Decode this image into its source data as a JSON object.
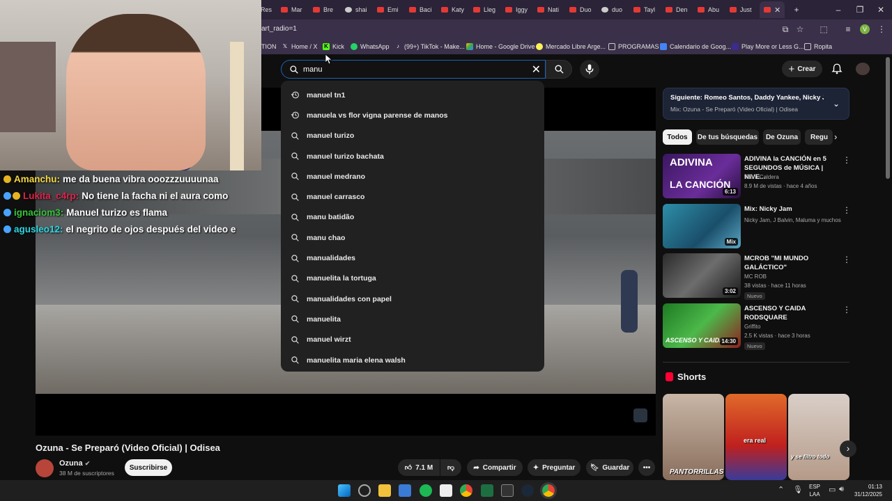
{
  "browser": {
    "tabs": [
      "Res",
      "Mar",
      "Bre",
      "shai",
      "Emi",
      "Baci",
      "Katy",
      "Lleg",
      "Iggy",
      "Nati",
      "Duo",
      "duo",
      "Tayl",
      "Den",
      "Abu",
      "Just"
    ],
    "new_tab": "+",
    "url": "art_radio=1",
    "bookmarks": [
      "TION",
      "Home / X",
      "Kick",
      "WhatsApp",
      "(99+) TikTok - Make...",
      "Home - Google Drive",
      "Mercado Libre Arge...",
      "PROGRAMAS",
      "Calendario de Goog...",
      "Play More or Less G...",
      "Ropita"
    ],
    "profile_initial": "V"
  },
  "chat": [
    {
      "user": "Amanchu:",
      "msg": "me da buena vibra ooozzzuuuunaa",
      "color": "#f5d742"
    },
    {
      "user": "Lukita_c4rp:",
      "msg": "No tiene la facha ni el aura como",
      "color": "#e0244c"
    },
    {
      "user": "ignaciom3:",
      "msg": "Manuel turizo es flama",
      "color": "#35c43a"
    },
    {
      "user": "agusleo12:",
      "msg": "el negrito de ojos después del video e",
      "color": "#2bd6e0"
    }
  ],
  "youtube": {
    "search_value": "manu",
    "suggestions": [
      {
        "text": "manuel tn1",
        "icon": "history-icon"
      },
      {
        "text": "manuela vs flor vigna parense de manos",
        "icon": "history-icon"
      },
      {
        "text": "manuel turizo",
        "icon": "search-icon"
      },
      {
        "text": "manuel turizo bachata",
        "icon": "search-icon"
      },
      {
        "text": "manuel medrano",
        "icon": "search-icon"
      },
      {
        "text": "manuel carrasco",
        "icon": "search-icon"
      },
      {
        "text": "manu batidão",
        "icon": "search-icon"
      },
      {
        "text": "manu chao",
        "icon": "search-icon"
      },
      {
        "text": "manualidades",
        "icon": "search-icon"
      },
      {
        "text": "manuelita la tortuga",
        "icon": "search-icon"
      },
      {
        "text": "manualidades con papel",
        "icon": "search-icon"
      },
      {
        "text": "manuelita",
        "icon": "search-icon"
      },
      {
        "text": "manuel wirzt",
        "icon": "search-icon"
      },
      {
        "text": "manuelita maria elena walsh",
        "icon": "search-icon"
      }
    ],
    "create_label": "Crear",
    "video": {
      "title": "Ozuna - Se Preparó (Video Oficial) | Odisea",
      "channel": "Ozuna",
      "subscribers": "38 M de suscriptores",
      "subscribe_label": "Suscribirse",
      "likes": "7.1 M",
      "share_label": "Compartir",
      "ask_label": "Preguntar",
      "save_label": "Guardar"
    },
    "next": {
      "title": "Siguiente: Romeo Santos, Daddy Yankee, Nicky Ja...",
      "subtitle": "Mix: Ozuna - Se Preparó (Video Oficial) | Odisea"
    },
    "chips": [
      "Todos",
      "De tus búsquedas",
      "De Ozuna",
      "Regu"
    ],
    "related": [
      {
        "title": "ADIVINA la CANCIÓN en 5 SEGUNDOS de MÚSICA | NIVE...",
        "channel": "Team Caldera",
        "meta": "8.9 M de vistas · hace 4 años",
        "duration": "6:13",
        "badge": ""
      },
      {
        "title": "Mix: Nicky Jam",
        "channel": "Nicky Jam, J Balvin, Maluma y muchos ...",
        "meta": "",
        "duration": "Mix",
        "badge": ""
      },
      {
        "title": "MCROB \"MI MUNDO GALÁCTICO\"",
        "channel": "MC ROB",
        "meta": "38 vistas · hace 11 horas",
        "duration": "3:02",
        "badge": "Nuevo"
      },
      {
        "title": "ASCENSO Y CAIDA RODSQUARE",
        "channel": "Griffito",
        "meta": "2.5 K vistas · hace 3 horas",
        "duration": "14:30",
        "badge": "Nuevo"
      }
    ],
    "shorts_label": "Shorts",
    "thumb_texts": {
      "adivina": "ADIVINA",
      "cancion": "LA CANCIÓN",
      "ascenso": "ASCENSO Y CAIDA"
    },
    "shorts_texts": [
      "PANTORRILLAS",
      "era real",
      "y se filtro todo"
    ]
  },
  "taskbar": {
    "lang": "ESP",
    "lang2": "LAA",
    "time": "01:13",
    "date": "31/12/2025"
  }
}
